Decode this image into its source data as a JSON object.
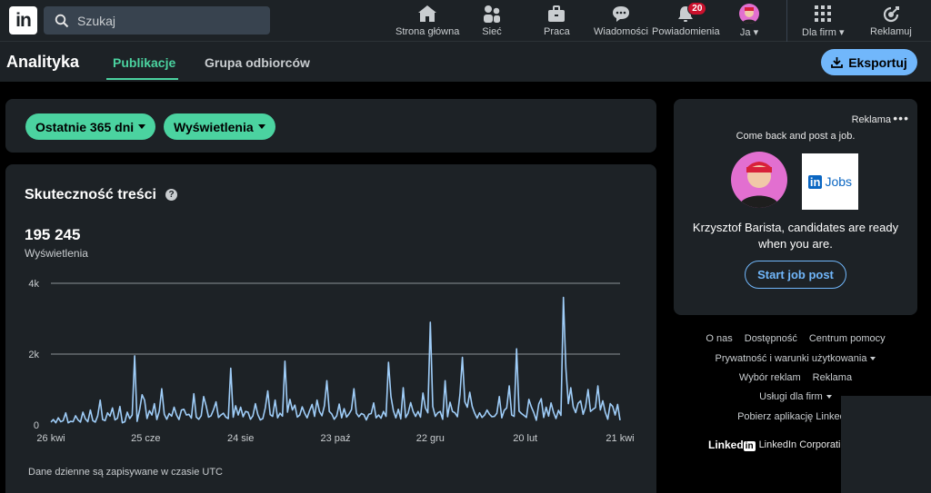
{
  "nav": {
    "logo": "in",
    "search_placeholder": "Szukaj",
    "items": [
      {
        "label": "Strona główna",
        "icon": "home-icon"
      },
      {
        "label": "Sieć",
        "icon": "network-icon"
      },
      {
        "label": "Praca",
        "icon": "briefcase-icon"
      },
      {
        "label": "Wiadomości",
        "icon": "message-icon"
      },
      {
        "label": "Powiadomienia",
        "icon": "bell-icon",
        "badge": "20"
      },
      {
        "label": "Ja",
        "icon": "avatar"
      },
      {
        "label": "Dla firm",
        "icon": "grid-icon"
      },
      {
        "label": "Reklamuj",
        "icon": "ad-icon"
      }
    ]
  },
  "subnav": {
    "title": "Analityka",
    "tabs": [
      "Publikacje",
      "Grupa odbiorców"
    ],
    "export_label": "Eksportuj"
  },
  "filters": {
    "period": "Ostatnie 365 dni",
    "metric": "Wyświetlenia"
  },
  "performance": {
    "title": "Skuteczność treści",
    "total": "195 245",
    "total_label": "Wyświetlenia",
    "note": "Dane dzienne są zapisywane w czasie UTC"
  },
  "chart_data": {
    "type": "line",
    "y_ticks": [
      "4k",
      "2k",
      "0"
    ],
    "ylim": [
      0,
      4000
    ],
    "x_ticks": [
      "26 kwi",
      "25 cze",
      "24 sie",
      "23 paź",
      "22 gru",
      "20 lut",
      "21 kwi"
    ],
    "series": [
      {
        "color": "#9fcdf8",
        "values": [
          80,
          150,
          60,
          200,
          90,
          120,
          340,
          60,
          100,
          90,
          260,
          140,
          80,
          360,
          170,
          90,
          420,
          120,
          80,
          260,
          700,
          150,
          120,
          340,
          250,
          480,
          140,
          190,
          520,
          60,
          90,
          360,
          180,
          280,
          1950,
          100,
          430,
          850,
          700,
          180,
          400,
          280,
          600,
          150,
          390,
          1020,
          300,
          160,
          320,
          250,
          500,
          280,
          150,
          420,
          440,
          280,
          300,
          190,
          880,
          220,
          160,
          260,
          800,
          540,
          220,
          260,
          430,
          650,
          210,
          280,
          330,
          220,
          180,
          1600,
          220,
          540,
          280,
          500,
          230,
          380,
          360,
          160,
          260,
          600,
          290,
          140,
          180,
          480,
          960,
          290,
          240,
          700,
          200,
          330,
          250,
          1800,
          360,
          720,
          420,
          560,
          220,
          280,
          510,
          330,
          200,
          400,
          580,
          240,
          700,
          380,
          260,
          540,
          1250,
          380,
          310,
          160,
          260,
          590,
          200,
          460,
          220,
          310,
          430,
          1020,
          330,
          230,
          320,
          290,
          140,
          300,
          320,
          620,
          200,
          280,
          190,
          380,
          240,
          1770,
          800,
          400,
          200,
          440,
          170,
          1050,
          210,
          330,
          630,
          380,
          240,
          380,
          220,
          900,
          480,
          340,
          2900,
          520,
          240,
          340,
          380,
          160,
          1250,
          230,
          640,
          380,
          340,
          230,
          860,
          1910,
          650,
          500,
          920,
          520,
          330,
          190,
          340,
          210,
          280,
          420,
          300,
          230,
          240,
          330,
          800,
          200,
          410,
          480,
          1100,
          280,
          240,
          2150,
          390,
          320,
          270,
          210,
          720,
          510,
          340,
          130,
          590,
          740,
          210,
          500,
          250,
          620,
          360,
          180,
          410,
          270,
          3600,
          1600,
          600,
          1050,
          510,
          350,
          610,
          680,
          300,
          510,
          1000,
          380,
          440,
          490,
          1100,
          420,
          680,
          360,
          160,
          600,
          520,
          280,
          580,
          130
        ]
      }
    ]
  },
  "ad": {
    "label": "Reklama",
    "tagline": "Come back and post a job.",
    "jobs_logo_in": "in",
    "jobs_logo_text": "Jobs",
    "message": "Krzysztof Barista, candidates are ready when you are.",
    "button": "Start job post"
  },
  "footer": {
    "row1": [
      "O nas",
      "Dostępność",
      "Centrum pomocy"
    ],
    "row2": "Prywatność i warunki użytkowania",
    "row3": [
      "Wybór reklam",
      "Reklama"
    ],
    "row4": "Usługi dla firm",
    "row5": "Pobierz aplikację LinkedIn",
    "brand_word": "Linked",
    "brand_in": "in",
    "brand_corp": "LinkedIn Corporation"
  }
}
